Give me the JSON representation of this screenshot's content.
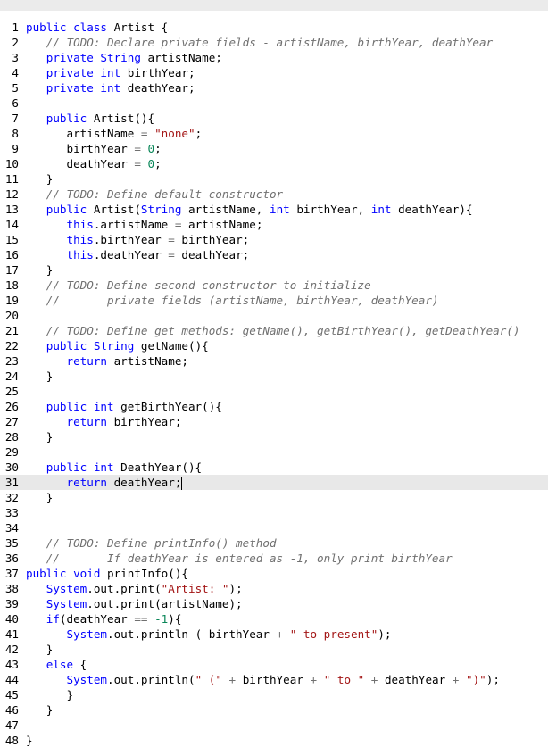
{
  "editor": {
    "active_line": 31,
    "lines": [
      {
        "n": "1",
        "tokens": [
          {
            "t": "public class ",
            "c": "kw"
          },
          {
            "t": "Artist {",
            "c": ""
          }
        ]
      },
      {
        "n": "2",
        "tokens": [
          {
            "t": "   ",
            "c": ""
          },
          {
            "t": "// TODO: Declare private fields - artistName, birthYear, deathYear",
            "c": "cm"
          }
        ]
      },
      {
        "n": "3",
        "tokens": [
          {
            "t": "   ",
            "c": ""
          },
          {
            "t": "private String ",
            "c": "kw"
          },
          {
            "t": "artistName;",
            "c": ""
          }
        ]
      },
      {
        "n": "4",
        "tokens": [
          {
            "t": "   ",
            "c": ""
          },
          {
            "t": "private int ",
            "c": "kw"
          },
          {
            "t": "birthYear;",
            "c": ""
          }
        ]
      },
      {
        "n": "5",
        "tokens": [
          {
            "t": "   ",
            "c": ""
          },
          {
            "t": "private int ",
            "c": "kw"
          },
          {
            "t": "deathYear;",
            "c": ""
          }
        ]
      },
      {
        "n": "6",
        "tokens": []
      },
      {
        "n": "7",
        "tokens": [
          {
            "t": "   ",
            "c": ""
          },
          {
            "t": "public ",
            "c": "kw"
          },
          {
            "t": "Artist(){",
            "c": ""
          }
        ]
      },
      {
        "n": "8",
        "tokens": [
          {
            "t": "      artistName ",
            "c": ""
          },
          {
            "t": "=",
            "c": "op"
          },
          {
            "t": " ",
            "c": ""
          },
          {
            "t": "\"none\"",
            "c": "str"
          },
          {
            "t": ";",
            "c": ""
          }
        ]
      },
      {
        "n": "9",
        "tokens": [
          {
            "t": "      birthYear ",
            "c": ""
          },
          {
            "t": "=",
            "c": "op"
          },
          {
            "t": " ",
            "c": ""
          },
          {
            "t": "0",
            "c": "num"
          },
          {
            "t": ";",
            "c": ""
          }
        ]
      },
      {
        "n": "10",
        "tokens": [
          {
            "t": "      deathYear ",
            "c": ""
          },
          {
            "t": "=",
            "c": "op"
          },
          {
            "t": " ",
            "c": ""
          },
          {
            "t": "0",
            "c": "num"
          },
          {
            "t": ";",
            "c": ""
          }
        ]
      },
      {
        "n": "11",
        "tokens": [
          {
            "t": "   }",
            "c": ""
          }
        ]
      },
      {
        "n": "12",
        "tokens": [
          {
            "t": "   ",
            "c": ""
          },
          {
            "t": "// TODO: Define default constructor",
            "c": "cm"
          }
        ]
      },
      {
        "n": "13",
        "tokens": [
          {
            "t": "   ",
            "c": ""
          },
          {
            "t": "public ",
            "c": "kw"
          },
          {
            "t": "Artist(",
            "c": ""
          },
          {
            "t": "String ",
            "c": "kw"
          },
          {
            "t": "artistName, ",
            "c": ""
          },
          {
            "t": "int ",
            "c": "kw"
          },
          {
            "t": "birthYear, ",
            "c": ""
          },
          {
            "t": "int ",
            "c": "kw"
          },
          {
            "t": "deathYear){",
            "c": ""
          }
        ]
      },
      {
        "n": "14",
        "tokens": [
          {
            "t": "      ",
            "c": ""
          },
          {
            "t": "this",
            "c": "kw"
          },
          {
            "t": ".artistName ",
            "c": ""
          },
          {
            "t": "=",
            "c": "op"
          },
          {
            "t": " artistName;",
            "c": ""
          }
        ]
      },
      {
        "n": "15",
        "tokens": [
          {
            "t": "      ",
            "c": ""
          },
          {
            "t": "this",
            "c": "kw"
          },
          {
            "t": ".birthYear ",
            "c": ""
          },
          {
            "t": "=",
            "c": "op"
          },
          {
            "t": " birthYear;",
            "c": ""
          }
        ]
      },
      {
        "n": "16",
        "tokens": [
          {
            "t": "      ",
            "c": ""
          },
          {
            "t": "this",
            "c": "kw"
          },
          {
            "t": ".deathYear ",
            "c": ""
          },
          {
            "t": "=",
            "c": "op"
          },
          {
            "t": " deathYear;",
            "c": ""
          }
        ]
      },
      {
        "n": "17",
        "tokens": [
          {
            "t": "   }",
            "c": ""
          }
        ]
      },
      {
        "n": "18",
        "tokens": [
          {
            "t": "   ",
            "c": ""
          },
          {
            "t": "// TODO: Define second constructor to initialize",
            "c": "cm"
          }
        ]
      },
      {
        "n": "19",
        "tokens": [
          {
            "t": "   ",
            "c": ""
          },
          {
            "t": "//       private fields (artistName, birthYear, deathYear)",
            "c": "cm"
          }
        ]
      },
      {
        "n": "20",
        "tokens": []
      },
      {
        "n": "21",
        "tokens": [
          {
            "t": "   ",
            "c": ""
          },
          {
            "t": "// TODO: Define get methods: getName(), getBirthYear(), getDeathYear()",
            "c": "cm"
          }
        ]
      },
      {
        "n": "22",
        "tokens": [
          {
            "t": "   ",
            "c": ""
          },
          {
            "t": "public String ",
            "c": "kw"
          },
          {
            "t": "getName(){",
            "c": ""
          }
        ]
      },
      {
        "n": "23",
        "tokens": [
          {
            "t": "      ",
            "c": ""
          },
          {
            "t": "return ",
            "c": "kw"
          },
          {
            "t": "artistName;",
            "c": ""
          }
        ]
      },
      {
        "n": "24",
        "tokens": [
          {
            "t": "   }",
            "c": ""
          }
        ]
      },
      {
        "n": "25",
        "tokens": []
      },
      {
        "n": "26",
        "tokens": [
          {
            "t": "   ",
            "c": ""
          },
          {
            "t": "public int ",
            "c": "kw"
          },
          {
            "t": "getBirthYear(){",
            "c": ""
          }
        ]
      },
      {
        "n": "27",
        "tokens": [
          {
            "t": "      ",
            "c": ""
          },
          {
            "t": "return ",
            "c": "kw"
          },
          {
            "t": "birthYear;",
            "c": ""
          }
        ]
      },
      {
        "n": "28",
        "tokens": [
          {
            "t": "   }",
            "c": ""
          }
        ]
      },
      {
        "n": "29",
        "tokens": []
      },
      {
        "n": "30",
        "tokens": [
          {
            "t": "   ",
            "c": ""
          },
          {
            "t": "public int ",
            "c": "kw"
          },
          {
            "t": "DeathYear(){",
            "c": ""
          }
        ]
      },
      {
        "n": "31",
        "tokens": [
          {
            "t": "      ",
            "c": ""
          },
          {
            "t": "return ",
            "c": "kw"
          },
          {
            "t": "deathYear;",
            "c": ""
          }
        ]
      },
      {
        "n": "32",
        "tokens": [
          {
            "t": "   }",
            "c": ""
          }
        ]
      },
      {
        "n": "33",
        "tokens": []
      },
      {
        "n": "34",
        "tokens": []
      },
      {
        "n": "35",
        "tokens": [
          {
            "t": "   ",
            "c": ""
          },
          {
            "t": "// TODO: Define printInfo() method",
            "c": "cm"
          }
        ]
      },
      {
        "n": "36",
        "tokens": [
          {
            "t": "   ",
            "c": ""
          },
          {
            "t": "//       If deathYear is entered as -1, only print birthYear",
            "c": "cm"
          }
        ]
      },
      {
        "n": "37",
        "tokens": [
          {
            "t": "public void ",
            "c": "kw"
          },
          {
            "t": "printInfo(){",
            "c": ""
          }
        ]
      },
      {
        "n": "38",
        "tokens": [
          {
            "t": "   ",
            "c": ""
          },
          {
            "t": "System",
            "c": "kw"
          },
          {
            "t": ".out.print(",
            "c": ""
          },
          {
            "t": "\"Artist: \"",
            "c": "str"
          },
          {
            "t": ");",
            "c": ""
          }
        ]
      },
      {
        "n": "39",
        "tokens": [
          {
            "t": "   ",
            "c": ""
          },
          {
            "t": "System",
            "c": "kw"
          },
          {
            "t": ".out.print(artistName);",
            "c": ""
          }
        ]
      },
      {
        "n": "40",
        "tokens": [
          {
            "t": "   ",
            "c": ""
          },
          {
            "t": "if",
            "c": "kw"
          },
          {
            "t": "(deathYear ",
            "c": ""
          },
          {
            "t": "==",
            "c": "op"
          },
          {
            "t": " ",
            "c": ""
          },
          {
            "t": "-1",
            "c": "num"
          },
          {
            "t": "){",
            "c": ""
          }
        ]
      },
      {
        "n": "41",
        "tokens": [
          {
            "t": "      ",
            "c": ""
          },
          {
            "t": "System",
            "c": "kw"
          },
          {
            "t": ".out.println ( birthYear ",
            "c": ""
          },
          {
            "t": "+",
            "c": "op"
          },
          {
            "t": " ",
            "c": ""
          },
          {
            "t": "\" to present\"",
            "c": "str"
          },
          {
            "t": ");",
            "c": ""
          }
        ]
      },
      {
        "n": "42",
        "tokens": [
          {
            "t": "   }",
            "c": ""
          }
        ]
      },
      {
        "n": "43",
        "tokens": [
          {
            "t": "   ",
            "c": ""
          },
          {
            "t": "else",
            "c": "kw"
          },
          {
            "t": " {",
            "c": ""
          }
        ]
      },
      {
        "n": "44",
        "tokens": [
          {
            "t": "      ",
            "c": ""
          },
          {
            "t": "System",
            "c": "kw"
          },
          {
            "t": ".out.println(",
            "c": ""
          },
          {
            "t": "\" (\"",
            "c": "str"
          },
          {
            "t": " ",
            "c": ""
          },
          {
            "t": "+",
            "c": "op"
          },
          {
            "t": " birthYear ",
            "c": ""
          },
          {
            "t": "+",
            "c": "op"
          },
          {
            "t": " ",
            "c": ""
          },
          {
            "t": "\" to \"",
            "c": "str"
          },
          {
            "t": " ",
            "c": ""
          },
          {
            "t": "+",
            "c": "op"
          },
          {
            "t": " deathYear ",
            "c": ""
          },
          {
            "t": "+",
            "c": "op"
          },
          {
            "t": " ",
            "c": ""
          },
          {
            "t": "\")\"",
            "c": "str"
          },
          {
            "t": ");",
            "c": ""
          }
        ]
      },
      {
        "n": "45",
        "tokens": [
          {
            "t": "      }",
            "c": ""
          }
        ]
      },
      {
        "n": "46",
        "tokens": [
          {
            "t": "   }",
            "c": ""
          }
        ]
      },
      {
        "n": "47",
        "tokens": []
      },
      {
        "n": "48",
        "tokens": [
          {
            "t": "}",
            "c": ""
          }
        ]
      }
    ]
  }
}
